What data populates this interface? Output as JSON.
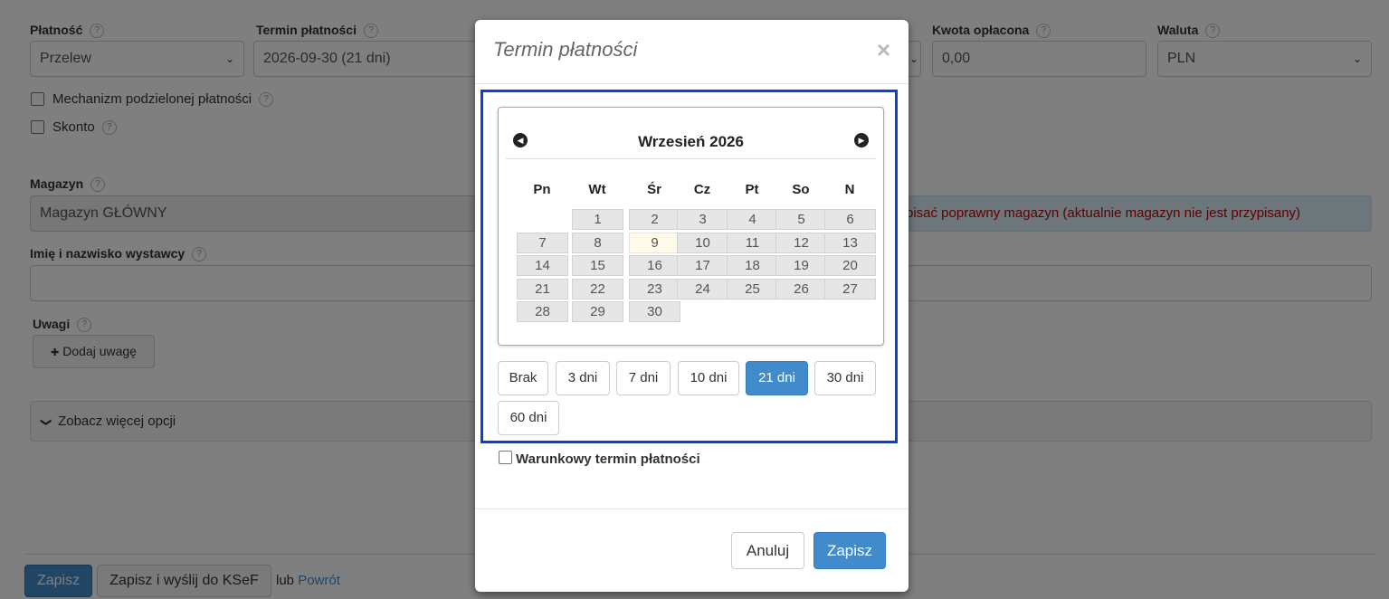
{
  "form": {
    "platnosc": {
      "label": "Płatność",
      "value": "Przelew"
    },
    "termin": {
      "label": "Termin płatności",
      "value": "2026-09-30 (21 dni)"
    },
    "kwota": {
      "label": "Kwota opłacona",
      "value": "0,00"
    },
    "waluta": {
      "label": "Waluta",
      "value": "PLN"
    },
    "mechanizm_label": "Mechanizm podzielonej płatności",
    "skonto_label": "Skonto",
    "magazyn": {
      "label": "Magazyn",
      "value": "Magazyn GŁÓWNY",
      "alert": "pisać poprawny magazyn (aktualnie magazyn nie jest przypisany)"
    },
    "wystawca_label": "Imię i nazwisko wystawcy",
    "uwagi_label": "Uwagi",
    "dodaj_uwage": "Dodaj uwagę",
    "wiecej_opcji": "Zobacz więcej opcji",
    "help_glyph": "?",
    "plus_glyph": "✚",
    "chevron_glyph": "❯",
    "caret_glyph": "⌄"
  },
  "footer": {
    "zapisz": "Zapisz",
    "zapisz_ksef": "Zapisz i wyślij do KSeF",
    "lub": "lub",
    "powrot": "Powrót"
  },
  "modal": {
    "title": "Termin płatności",
    "close": "×",
    "calendar": {
      "month_label": "Wrzesień 2026",
      "prev": "◀",
      "next": "▶",
      "weekdays": [
        "Pn",
        "Wt",
        "Śr",
        "Cz",
        "Pt",
        "So",
        "N"
      ],
      "days": [
        "1",
        "2",
        "3",
        "4",
        "5",
        "6",
        "7",
        "8",
        "9",
        "10",
        "11",
        "12",
        "13",
        "14",
        "15",
        "16",
        "17",
        "18",
        "19",
        "20",
        "21",
        "22",
        "23",
        "24",
        "25",
        "26",
        "27",
        "28",
        "29",
        "30"
      ],
      "first_weekday_index": 1,
      "today": "9"
    },
    "quick_buttons": [
      "Brak",
      "3 dni",
      "7 dni",
      "10 dni",
      "21 dni",
      "30 dni",
      "60 dni"
    ],
    "active_quick": "21 dni",
    "warunkowy_label": "Warunkowy termin płatności",
    "anuluj": "Anuluj",
    "zapisz": "Zapisz"
  },
  "colors": {
    "primary": "#428bca",
    "highlight_border": "#0a3fd6",
    "alert_text": "#c00000"
  }
}
